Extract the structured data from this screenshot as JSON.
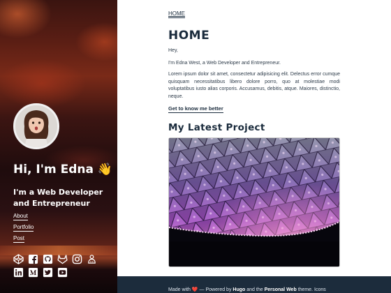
{
  "sidebar": {
    "name": "Hi, I'm Edna 👋",
    "tagline": "I'm a Web Developer and Entrepreneur",
    "nav": [
      {
        "label": "About"
      },
      {
        "label": "Portfolio"
      },
      {
        "label": "Post"
      }
    ],
    "social_icons": [
      [
        "codepen-icon",
        "facebook-icon",
        "github-icon",
        "gitlab-icon",
        "instagram-icon",
        "keybase-icon"
      ],
      [
        "linkedin-icon",
        "medium-icon",
        "twitter-icon",
        "youtube-icon"
      ]
    ]
  },
  "main": {
    "breadcrumb": "HOME",
    "title": "HOME",
    "greeting": "Hey,",
    "intro": "I'm Edna West, a Web Developer and Entrepreneur.",
    "body": "Lorem ipsum dolor sit amet, consectetur adipisicing elit. Delectus error cumque quisquam necessitatibus libero dolore porro, quo at molestiae modi voluptatibus iusto alias corporis. Accusamus, debitis, atque. Maiores, distinctio, neque.",
    "read_more": "Get to know me better",
    "section_title": "My Latest Project"
  },
  "footer": {
    "made_with": "Made with",
    "dash_powered_by": "— Powered by",
    "hugo": "Hugo",
    "and_the": "and the",
    "theme_name": "Personal Web",
    "theme_icons": "theme. Icons"
  },
  "colors": {
    "text_dark": "#1a2b3c",
    "footer_bg": "#1c2c3c",
    "heart": "#e0453a"
  }
}
